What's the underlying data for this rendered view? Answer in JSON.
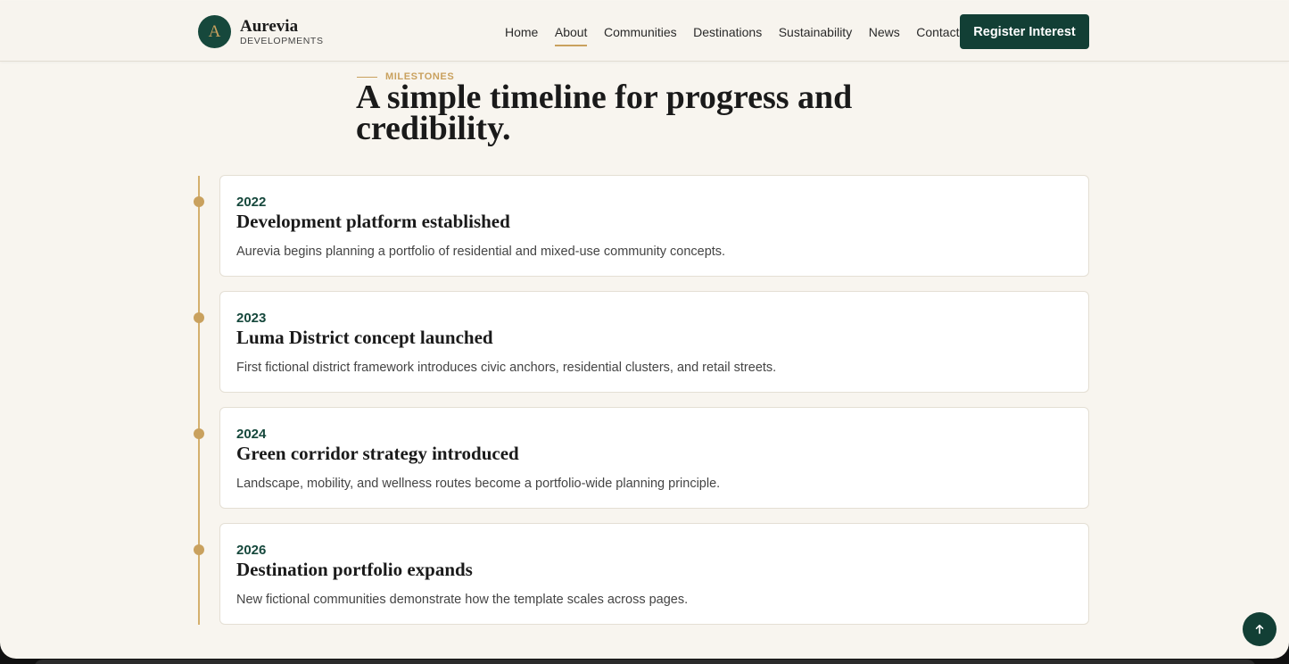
{
  "brand": {
    "mark": "A",
    "name": "Aurevia",
    "sub": "DEVELOPMENTS"
  },
  "nav": {
    "items": [
      "Home",
      "About",
      "Communities",
      "Destinations",
      "Sustainability",
      "News",
      "Contact"
    ],
    "active": "About",
    "cta": "Register Interest"
  },
  "section": {
    "eyebrow": "MILESTONES",
    "title": "A simple timeline for progress and credibility."
  },
  "timeline": [
    {
      "year": "2022",
      "title": "Development platform established",
      "desc": "Aurevia begins planning a portfolio of residential and mixed-use community concepts."
    },
    {
      "year": "2023",
      "title": "Luma District concept launched",
      "desc": "First fictional district framework introduces civic anchors, residential clusters, and retail streets."
    },
    {
      "year": "2024",
      "title": "Green corridor strategy introduced",
      "desc": "Landscape, mobility, and wellness routes become a portfolio-wide planning principle."
    },
    {
      "year": "2026",
      "title": "Destination portfolio expands",
      "desc": "New fictional communities demonstrate how the template scales across pages."
    }
  ],
  "icons": {
    "back_to_top": "arrow-up-icon"
  },
  "colors": {
    "primary": "#123f35",
    "accent": "#c9a15e",
    "background": "#f8f5ef"
  }
}
